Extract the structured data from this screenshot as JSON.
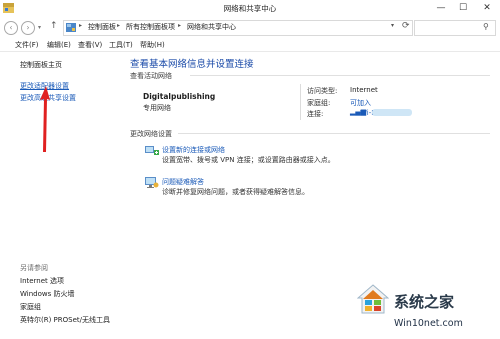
{
  "window": {
    "title": "网络和共享中心",
    "minimize": "—",
    "maximize": "☐",
    "close": "✕"
  },
  "address": {
    "back": "‹",
    "forward": "›",
    "history_dropdown": "▾",
    "up": "↑",
    "crumbs": [
      "控制面板",
      "所有控制面板项",
      "网络和共享中心"
    ],
    "separator": "▸",
    "dropdown": "▾",
    "refresh": "⟳",
    "search_icon": "⚲"
  },
  "menu": [
    "文件(F)",
    "编辑(E)",
    "查看(V)",
    "工具(T)",
    "帮助(H)"
  ],
  "left_pane": {
    "home": "控制面板主页",
    "links": [
      "更改适配器设置",
      "更改高级共享设置"
    ],
    "see_also_title": "另请参阅",
    "see_also": [
      "Internet 选项",
      "Windows 防火墙",
      "家庭组",
      "英特尔(R) PROSet/无线工具"
    ]
  },
  "main": {
    "heading": "查看基本网络信息并设置连接",
    "active_label": "查看活动网络",
    "network_name": "Digitalpublishing",
    "network_type": "专用网络",
    "access_type_label": "访问类型:",
    "access_type_value": "Internet",
    "homegroup_label": "家庭组:",
    "homegroup_value": "可加入",
    "connection_label": "连接:",
    "connection_value": "Wi-Fi",
    "change_label": "更改网络设置",
    "new_connection_link": "设置新的连接或网络",
    "new_connection_desc": "设置宽带、拨号或 VPN 连接；或设置路由器或接入点。",
    "troubleshoot_link": "问题疑难解答",
    "troubleshoot_desc": "诊断并修复网络问题，或者获得疑难解答信息。"
  },
  "watermark": {
    "text": "系统之家",
    "url": "Win10net.com"
  },
  "colors": {
    "link": "#1a5ab8",
    "heading": "#1a4aa8",
    "annotation_arrow": "#e02020"
  }
}
